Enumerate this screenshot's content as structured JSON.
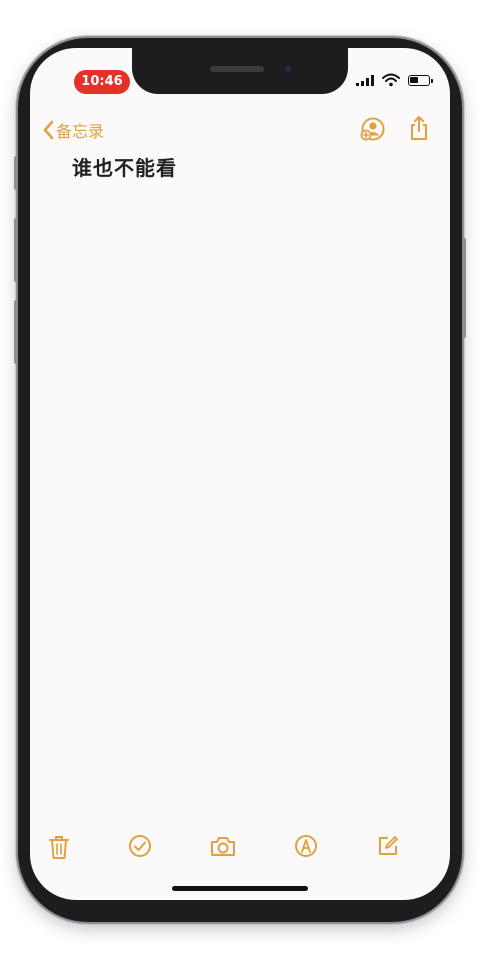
{
  "status_bar": {
    "time": "10:46"
  },
  "nav": {
    "back_label": "备忘录"
  },
  "note": {
    "title": "谁也不能看"
  },
  "toolbar": {
    "items": [
      "trash-icon",
      "checklist-icon",
      "camera-icon",
      "markup-icon",
      "compose-icon"
    ]
  },
  "colors": {
    "accent": "#e1a140",
    "time_pill": "#e5312a",
    "screen_bg": "#fcf9fa"
  }
}
